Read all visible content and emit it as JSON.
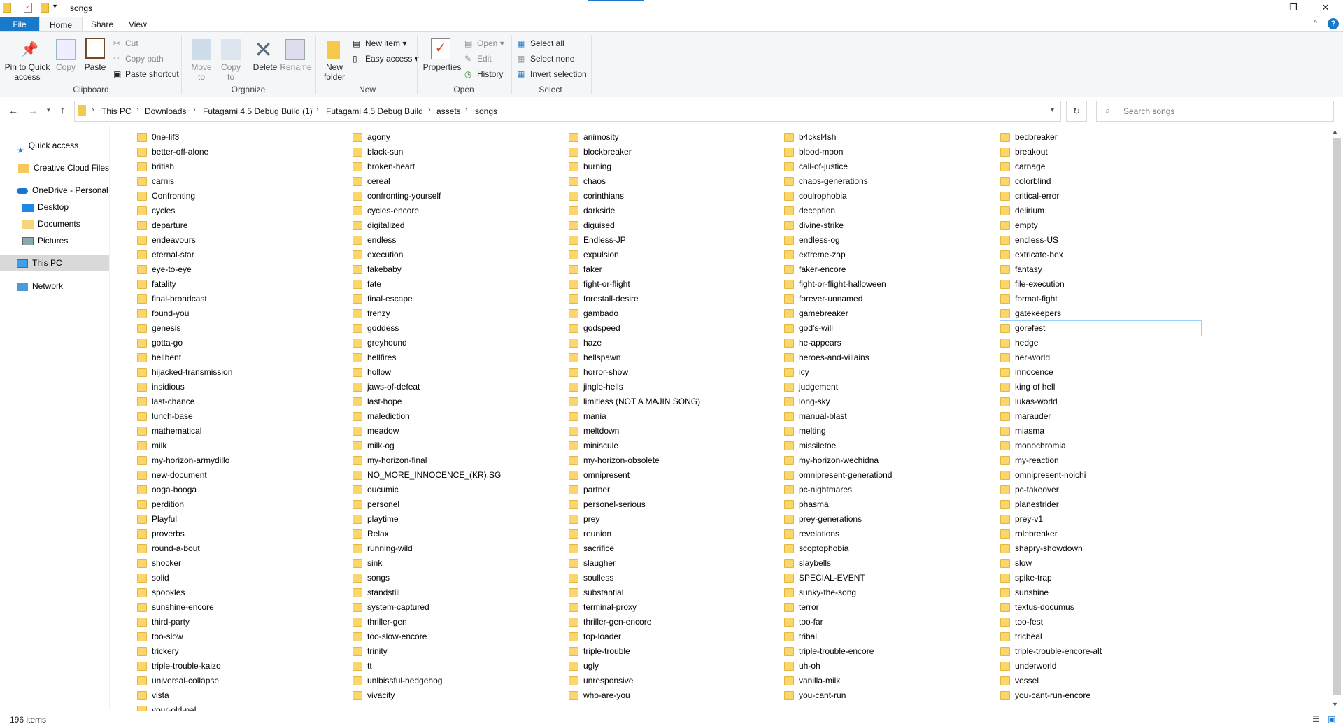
{
  "window": {
    "title": "songs"
  },
  "tabs": [
    "File",
    "Home",
    "Share",
    "View"
  ],
  "ribbon": {
    "clipboard": {
      "label": "Clipboard",
      "pin": "Pin to Quick access",
      "copy": "Copy",
      "paste": "Paste",
      "cut": "Cut",
      "copy_path": "Copy path",
      "paste_shortcut": "Paste shortcut"
    },
    "organize": {
      "label": "Organize",
      "move_to": "Move to",
      "copy_to": "Copy to",
      "delete": "Delete",
      "rename": "Rename"
    },
    "new": {
      "label": "New",
      "new_folder": "New folder",
      "new_item": "New item ▾",
      "easy_access": "Easy access ▾"
    },
    "open": {
      "label": "Open",
      "properties": "Properties",
      "open": "Open ▾",
      "edit": "Edit",
      "history": "History"
    },
    "select": {
      "label": "Select",
      "select_all": "Select all",
      "select_none": "Select none",
      "invert": "Invert selection"
    }
  },
  "breadcrumb": [
    "This PC",
    "Downloads",
    "Futagami 4.5 Debug Build (1)",
    "Futagami 4.5 Debug Build",
    "assets",
    "songs"
  ],
  "search": {
    "placeholder": "Search songs"
  },
  "sidebar": [
    "Quick access",
    "Creative Cloud Files",
    "OneDrive - Personal",
    "Desktop",
    "Documents",
    "Pictures",
    "This PC",
    "Network"
  ],
  "status": {
    "count": "196 items"
  },
  "selected": "gorefest",
  "columns": [
    [
      "0ne-lif3",
      "better-off-alone",
      "british",
      "carnis",
      "Confronting",
      "cycles",
      "departure",
      "endeavours",
      "eternal-star",
      "eye-to-eye",
      "fatality",
      "final-broadcast",
      "found-you",
      "genesis",
      "gotta-go",
      "hellbent",
      "hijacked-transmission",
      "insidious",
      "last-chance",
      "lunch-base",
      "mathematical",
      "milk",
      "my-horizon-armydillo",
      "new-document",
      "ooga-booga",
      "perdition",
      "Playful",
      "proverbs",
      "round-a-bout",
      "shocker",
      "solid",
      "spookles",
      "sunshine-encore",
      "third-party",
      "too-slow",
      "trickery",
      "triple-trouble-kaizo",
      "universal-collapse",
      "vista",
      "your-old-pal"
    ],
    [
      "agony",
      "black-sun",
      "broken-heart",
      "cereal",
      "confronting-yourself",
      "cycles-encore",
      "digitalized",
      "endless",
      "execution",
      "fakebaby",
      "fate",
      "final-escape",
      "frenzy",
      "goddess",
      "greyhound",
      "hellfires",
      "hollow",
      "jaws-of-defeat",
      "last-hope",
      "malediction",
      "meadow",
      "milk-og",
      "my-horizon-final",
      "NO_MORE_INNOCENCE_(KR).SG",
      "oucumic",
      "personel",
      "playtime",
      "Relax",
      "running-wild",
      "sink",
      "songs",
      "standstill",
      "system-captured",
      "thriller-gen",
      "too-slow-encore",
      "trinity",
      "tt",
      "unlbissful-hedgehog",
      "vivacity"
    ],
    [
      "animosity",
      "blockbreaker",
      "burning",
      "chaos",
      "corinthians",
      "darkside",
      "diguised",
      "Endless-JP",
      "expulsion",
      "faker",
      "fight-or-flight",
      "forestall-desire",
      "gambado",
      "godspeed",
      "haze",
      "hellspawn",
      "horror-show",
      "jingle-hells",
      "limitless (NOT A MAJIN SONG)",
      "mania",
      "meltdown",
      "miniscule",
      "my-horizon-obsolete",
      "omnipresent",
      "partner",
      "personel-serious",
      "prey",
      "reunion",
      "sacrifice",
      "slaugher",
      "soulless",
      "substantial",
      "terminal-proxy",
      "thriller-gen-encore",
      "top-loader",
      "triple-trouble",
      "ugly",
      "unresponsive",
      "who-are-you"
    ],
    [
      "b4cksl4sh",
      "blood-moon",
      "call-of-justice",
      "chaos-generations",
      "coulrophobia",
      "deception",
      "divine-strike",
      "endless-og",
      "extreme-zap",
      "faker-encore",
      "fight-or-flight-halloween",
      "forever-unnamed",
      "gamebreaker",
      "god's-will",
      "he-appears",
      "heroes-and-villains",
      "icy",
      "judgement",
      "long-sky",
      "manual-blast",
      "melting",
      "missiletoe",
      "my-horizon-wechidna",
      "omnipresent-generationd",
      "pc-nightmares",
      "phasma",
      "prey-generations",
      "revelations",
      "scoptophobia",
      "slaybells",
      "SPECIAL-EVENT",
      "sunky-the-song",
      "terror",
      "too-far",
      "tribal",
      "triple-trouble-encore",
      "uh-oh",
      "vanilla-milk",
      "you-cant-run"
    ],
    [
      "bedbreaker",
      "breakout",
      "carnage",
      "colorblind",
      "critical-error",
      "delirium",
      "empty",
      "endless-US",
      "extricate-hex",
      "fantasy",
      "file-execution",
      "format-fight",
      "gatekeepers",
      "gorefest",
      "hedge",
      "her-world",
      "innocence",
      "king of hell",
      "lukas-world",
      "marauder",
      "miasma",
      "monochromia",
      "my-reaction",
      "omnipresent-noichi",
      "pc-takeover",
      "planestrider",
      "prey-v1",
      "rolebreaker",
      "shapry-showdown",
      "slow",
      "spike-trap",
      "sunshine",
      "textus-documus",
      "too-fest",
      "tricheal",
      "triple-trouble-encore-alt",
      "underworld",
      "vessel",
      "you-cant-run-encore"
    ]
  ],
  "colors": {
    "accent": "#1979ca",
    "folder": "#fbd66a",
    "selection_border": "#99d1ff",
    "nav_selected": "#d9d9d9"
  }
}
